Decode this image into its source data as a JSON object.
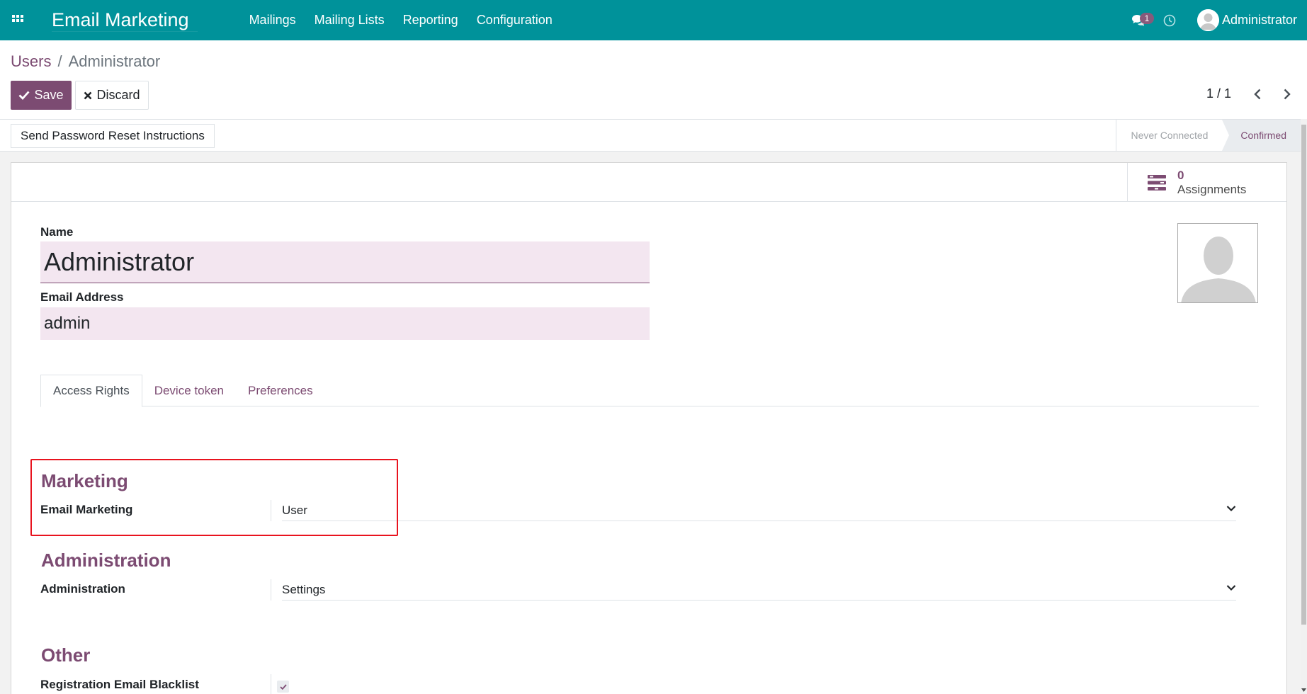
{
  "navbar": {
    "app_title": "Email Marketing",
    "menu": [
      "Mailings",
      "Mailing Lists",
      "Reporting",
      "Configuration"
    ],
    "chat_badge": "1",
    "user_name": "Administrator"
  },
  "breadcrumb": {
    "parent": "Users",
    "separator": "/",
    "current": "Administrator"
  },
  "buttons": {
    "save": "Save",
    "discard": "Discard"
  },
  "pager": {
    "value": "1 / 1"
  },
  "statusbar": {
    "reset_button": "Send Password Reset Instructions",
    "stages": [
      "Never Connected",
      "Confirmed"
    ],
    "active_stage": "Confirmed"
  },
  "stat_button": {
    "value": "0",
    "label": "Assignments"
  },
  "form": {
    "name_label": "Name",
    "name_value": "Administrator",
    "email_label": "Email Address",
    "email_value": "admin"
  },
  "tabs": [
    "Access Rights",
    "Device token",
    "Preferences"
  ],
  "groups": {
    "marketing": {
      "title": "Marketing",
      "field_label": "Email Marketing",
      "field_value": "User"
    },
    "administration": {
      "title": "Administration",
      "field_label": "Administration",
      "field_value": "Settings"
    },
    "other": {
      "title": "Other",
      "field_label": "Registration Email Blacklist",
      "checked": true
    }
  },
  "colors": {
    "navbar": "#00929a",
    "primary": "#7c4b72",
    "input_bg": "#f3e6f0",
    "highlight": "#e8131e"
  }
}
